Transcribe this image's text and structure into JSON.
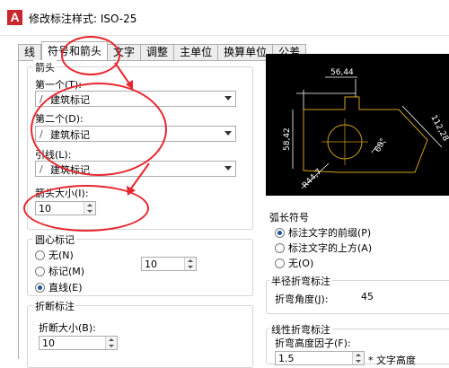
{
  "window": {
    "title": "修改标注样式: ISO-25",
    "app_icon": "autocad-icon"
  },
  "tabs": [
    {
      "label": "线",
      "active": false
    },
    {
      "label": "符号和箭头",
      "active": true
    },
    {
      "label": "文字",
      "active": false
    },
    {
      "label": "调整",
      "active": false
    },
    {
      "label": "主单位",
      "active": false
    },
    {
      "label": "换算单位",
      "active": false
    },
    {
      "label": "公差",
      "active": false
    }
  ],
  "arrowheads": {
    "title": "箭头",
    "first_label": "第一个(T):",
    "first_value": "建筑标记",
    "second_label": "第二个(D):",
    "second_value": "建筑标记",
    "leader_label": "引线(L):",
    "leader_value": "建筑标记",
    "size_label": "箭头大小(I):",
    "size_value": "10"
  },
  "center_marks": {
    "title": "圆心标记",
    "options": [
      "无(N)",
      "标记(M)",
      "直线(E)"
    ],
    "selected": "直线(E)",
    "size_value": "10"
  },
  "dim_break": {
    "title": "折断标注",
    "size_label": "折断大小(B):",
    "size_value": "10"
  },
  "arc_length": {
    "title": "弧长符号",
    "options": [
      "标注文字的前缀(P)",
      "标注文字的上方(A)",
      "无(O)"
    ],
    "selected": "标注文字的前缀(P)"
  },
  "radius_jog": {
    "title": "半径折弯标注",
    "angle_label": "折弯角度(J):",
    "angle_value": "45"
  },
  "linear_jog": {
    "title": "线性折弯标注",
    "factor_label": "折弯高度因子(F):",
    "factor_value": "1.5",
    "suffix_text": "* 文字高度"
  },
  "preview": {
    "dims": [
      "56,44",
      "58,42",
      "112,28",
      "60°",
      "R44,7"
    ]
  },
  "colors": {
    "annotation": "#e8262f",
    "preview_bg": "#000000",
    "preview_geo": "#d4a017",
    "preview_dim": "#ffffff"
  }
}
